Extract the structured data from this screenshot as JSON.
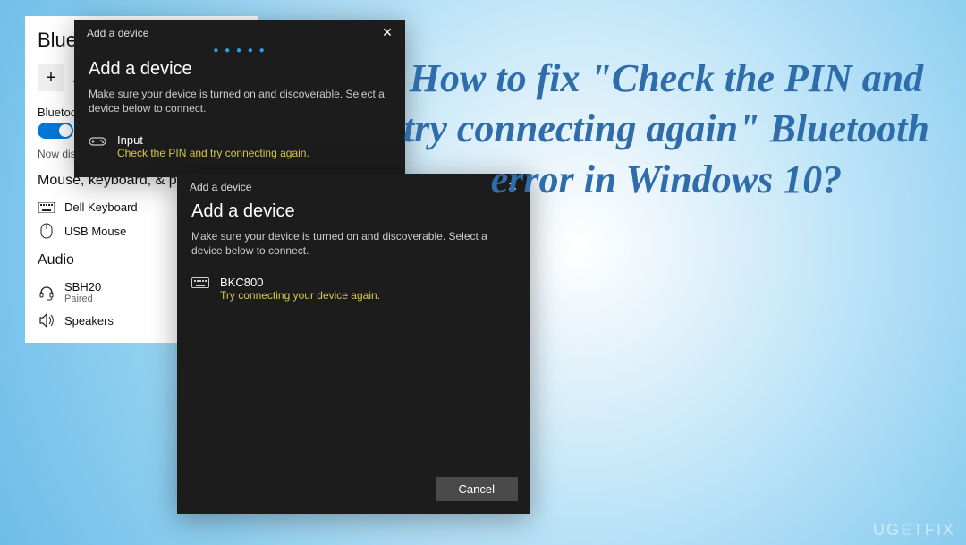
{
  "settings": {
    "heading": "Bluetooth",
    "add_label": "Add Bluetooth or other device",
    "bt_label": "Bluetooth",
    "toggle_state": "On",
    "discover_text": "Now discoverable as",
    "mouse_heading": "Mouse, keyboard, & pen",
    "devices": {
      "kb": "Dell Keyboard",
      "mouse": "USB Mouse"
    },
    "audio_heading": "Audio",
    "audio_devices": {
      "headset": "SBH20",
      "headset_sub": "Paired",
      "speakers": "Speakers"
    }
  },
  "dialog1": {
    "titlebar": "Add a device",
    "heading": "Add a device",
    "instruction": "Make sure your device is turned on and discoverable. Select a device below to connect.",
    "device": {
      "name": "Input",
      "error": "Check the PIN and try connecting again."
    }
  },
  "dialog2": {
    "titlebar": "Add a device",
    "heading": "Add a device",
    "instruction": "Make sure your device is turned on and discoverable. Select a device below to connect.",
    "device": {
      "name": "BKC800",
      "error": "Try connecting your device again."
    },
    "cancel": "Cancel"
  },
  "overlay": "How to fix \"Check the PIN and try connecting again\" Bluetooth error in Windows 10?",
  "watermark": {
    "brand": "UG",
    "mid": "E",
    "tail": "TFIX"
  }
}
